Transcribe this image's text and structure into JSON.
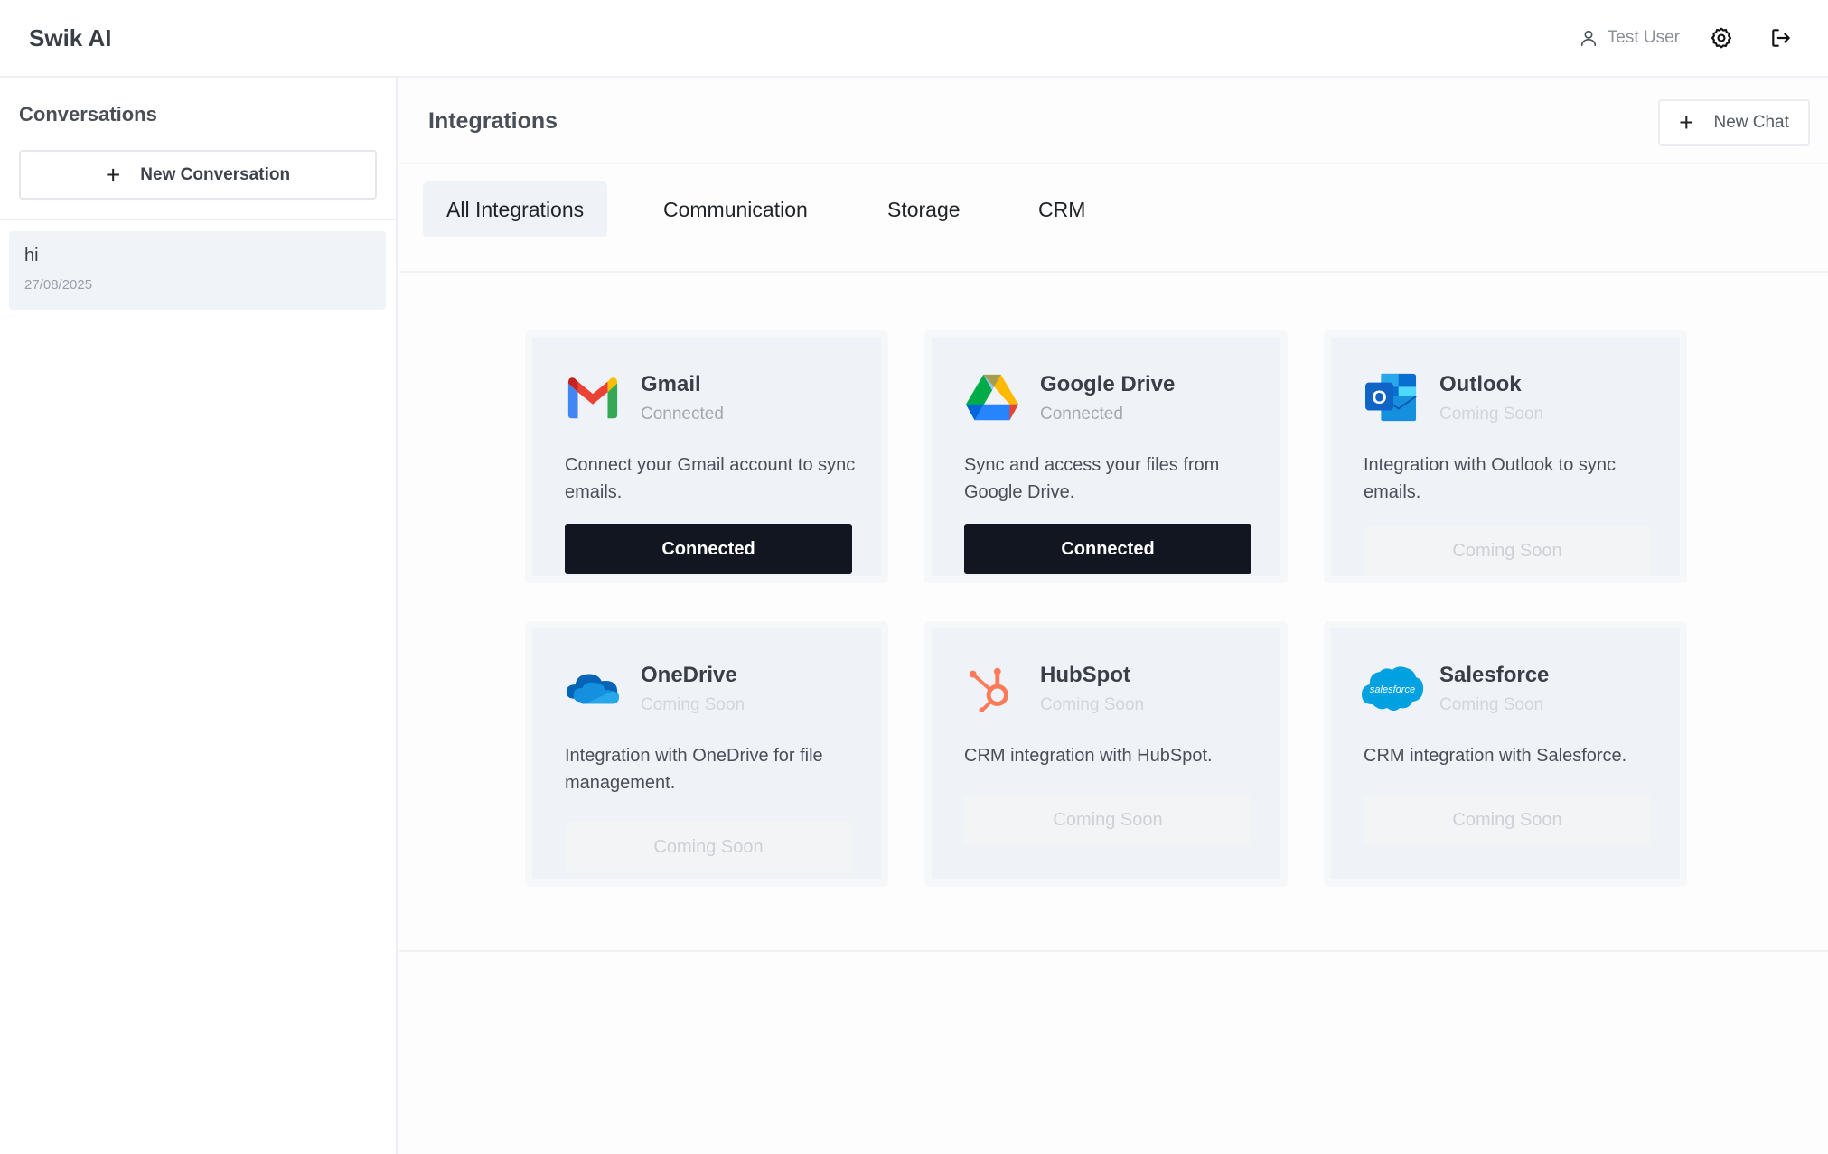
{
  "header": {
    "brand": "Swik AI",
    "user_name": "Test User"
  },
  "sidebar": {
    "title": "Conversations",
    "new_conversation_label": "New Conversation",
    "conversations": [
      {
        "title": "hi",
        "date": "27/08/2025"
      }
    ]
  },
  "main": {
    "title": "Integrations",
    "new_chat_label": "New Chat",
    "tabs": [
      {
        "label": "All Integrations"
      },
      {
        "label": "Communication"
      },
      {
        "label": "Storage"
      },
      {
        "label": "CRM"
      }
    ],
    "integrations": [
      {
        "name": "Gmail",
        "status": "Connected",
        "description": "Connect your Gmail account to sync emails.",
        "button": "Connected",
        "icon": "gmail-icon"
      },
      {
        "name": "Google Drive",
        "status": "Connected",
        "description": "Sync and access your files from Google Drive.",
        "button": "Connected",
        "icon": "google-drive-icon"
      },
      {
        "name": "Outlook",
        "status": "Coming Soon",
        "description": "Integration with Outlook to sync emails.",
        "button": "Coming Soon",
        "icon": "outlook-icon"
      },
      {
        "name": "OneDrive",
        "status": "Coming Soon",
        "description": "Integration with OneDrive for file management.",
        "button": "Coming Soon",
        "icon": "onedrive-icon"
      },
      {
        "name": "HubSpot",
        "status": "Coming Soon",
        "description": "CRM integration with HubSpot.",
        "button": "Coming Soon",
        "icon": "hubspot-icon"
      },
      {
        "name": "Salesforce",
        "status": "Coming Soon",
        "description": "CRM integration with Salesforce.",
        "button": "Coming Soon",
        "icon": "salesforce-icon",
        "logo_text": "salesforce"
      }
    ]
  },
  "colors": {
    "primary_button": "#121620",
    "active_tab": "#eff2f6",
    "card_background": "#eff2f6"
  }
}
